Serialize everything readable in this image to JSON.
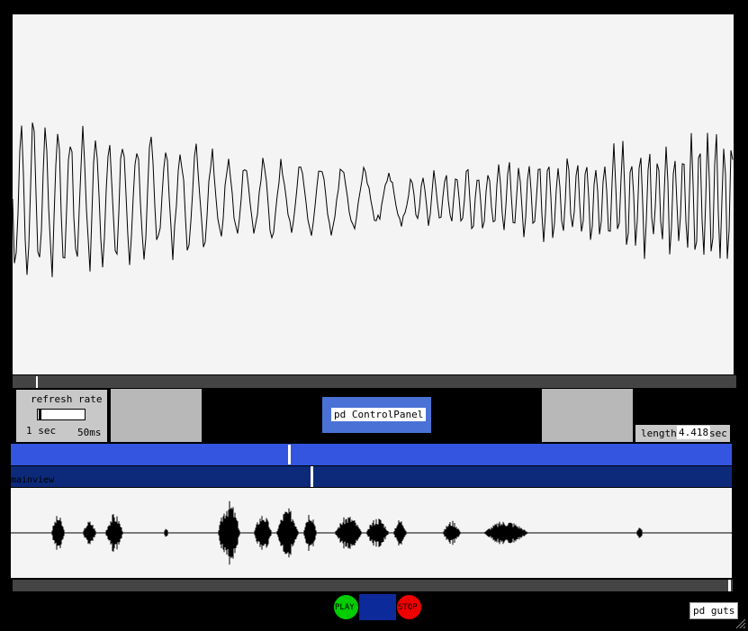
{
  "refresh": {
    "label": "refresh rate",
    "min_label": "1 sec",
    "max_label": "50ms"
  },
  "control_panel": {
    "label": "pd ControlPanel"
  },
  "length": {
    "label": "length",
    "value": "4.418",
    "unit": "sec"
  },
  "mainview": {
    "label": "mainview"
  },
  "transport": {
    "play_label": "PLAY",
    "stop_label": "STOP"
  },
  "guts": {
    "label": "pd guts"
  },
  "colors": {
    "accent_blue": "#3355e0",
    "dark_blue": "#0d2a7a",
    "play": "#00cc00",
    "stop": "#ee0000"
  }
}
